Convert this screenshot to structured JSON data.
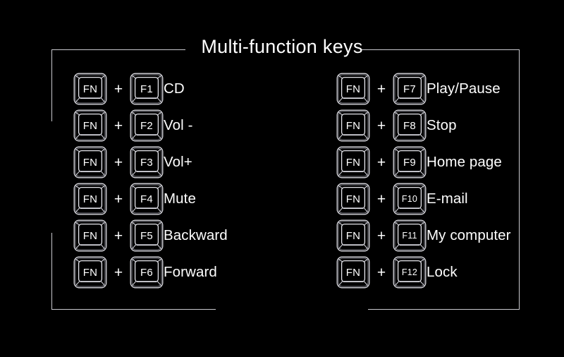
{
  "page": {
    "title": "Multi-function keys",
    "background_color": "#000000",
    "frame_color": "#c9c9cf",
    "text_color": "#ffffff"
  },
  "modifier_key_label": "FN",
  "plus_symbol": "+",
  "columns": [
    {
      "id": "left",
      "rows": [
        {
          "modifier": "FN",
          "plus": "+",
          "key": "F1",
          "function": "CD"
        },
        {
          "modifier": "FN",
          "plus": "+",
          "key": "F2",
          "function": "Vol -"
        },
        {
          "modifier": "FN",
          "plus": "+",
          "key": "F3",
          "function": "Vol+"
        },
        {
          "modifier": "FN",
          "plus": "+",
          "key": "F4",
          "function": "Mute"
        },
        {
          "modifier": "FN",
          "plus": "+",
          "key": "F5",
          "function": "Backward"
        },
        {
          "modifier": "FN",
          "plus": "+",
          "key": "F6",
          "function": "Forward"
        }
      ]
    },
    {
      "id": "right",
      "rows": [
        {
          "modifier": "FN",
          "plus": "+",
          "key": "F7",
          "function": "Play/Pause"
        },
        {
          "modifier": "FN",
          "plus": "+",
          "key": "F8",
          "function": "Stop"
        },
        {
          "modifier": "FN",
          "plus": "+",
          "key": "F9",
          "function": "Home page"
        },
        {
          "modifier": "FN",
          "plus": "+",
          "key": "F10",
          "function": "E-mail"
        },
        {
          "modifier": "FN",
          "plus": "+",
          "key": "F11",
          "function": "My computer"
        },
        {
          "modifier": "FN",
          "plus": "+",
          "key": "F12",
          "function": "Lock"
        }
      ]
    }
  ]
}
